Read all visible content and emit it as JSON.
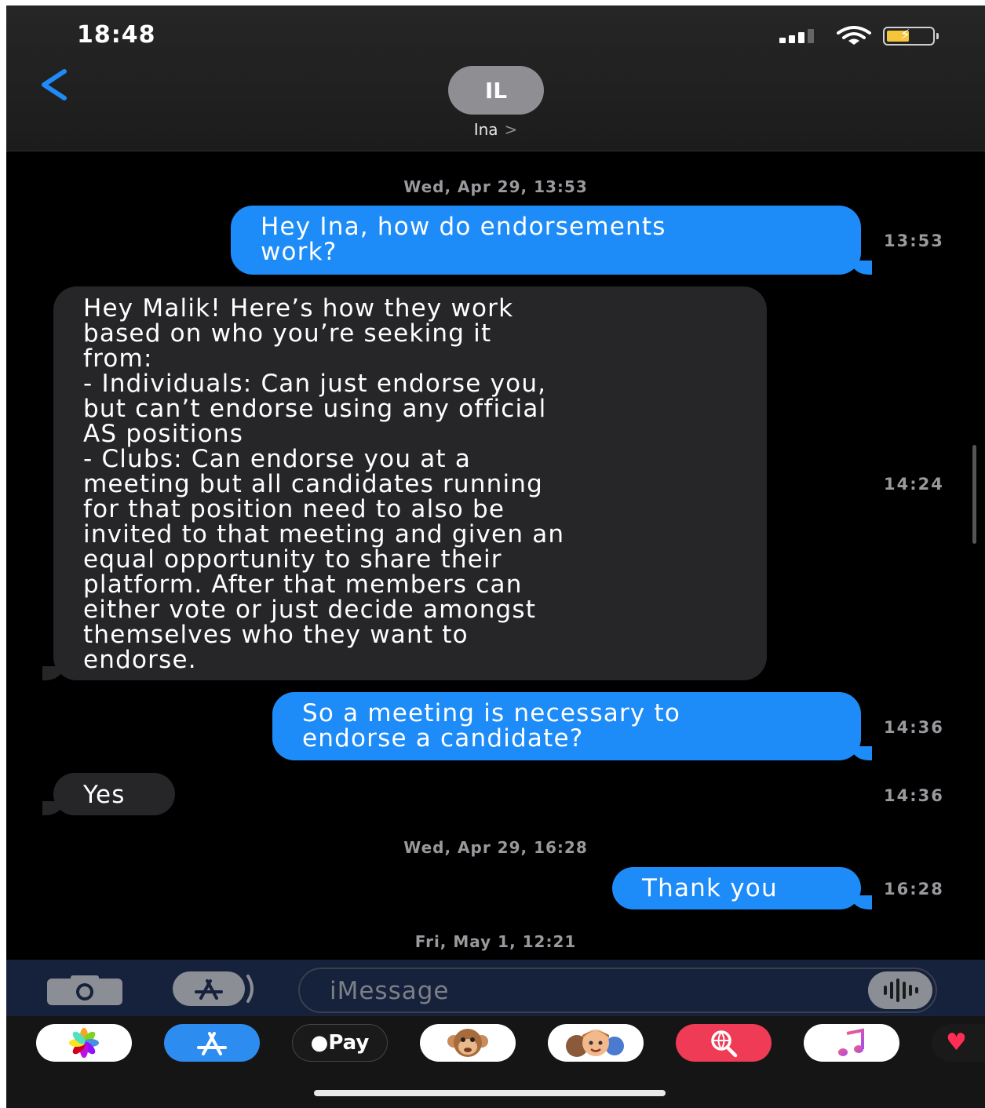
{
  "status_bar": {
    "time": "18:48"
  },
  "header": {
    "avatar_initials": "IL",
    "contact_name": "Ina",
    "chevron": ">"
  },
  "messages": [
    {
      "type": "timestamp",
      "text": "Wed, Apr 29, 13:53"
    },
    {
      "type": "sent",
      "text": "Hey Ina, how do endorsements\nwork?",
      "time": "13:53"
    },
    {
      "type": "received",
      "text": "Hey Malik! Here’s how they work\nbased on who you’re seeking it\nfrom:\n- Individuals: Can just endorse you,\nbut can’t endorse using any official\nAS positions\n- Clubs: Can endorse you at a\nmeeting but all candidates running\nfor that position need to also be\ninvited to that meeting and given an\nequal opportunity to share their\nplatform. After that members can\neither vote or just decide amongst\nthemselves who they want to\nendorse.",
      "time": "14:24"
    },
    {
      "type": "sent",
      "text": "So a meeting is necessary to\nendorse a candidate?",
      "time": "14:36"
    },
    {
      "type": "received",
      "text": "Yes",
      "time": "14:36"
    },
    {
      "type": "timestamp",
      "text": "Wed, Apr 29, 16:28"
    },
    {
      "type": "sent",
      "text": "Thank you",
      "time": "16:28"
    },
    {
      "type": "timestamp",
      "text": "Fri, May 1, 12:21"
    }
  ],
  "compose": {
    "placeholder": "iMessage"
  },
  "drawer": {
    "apps": [
      {
        "name": "photos-app",
        "label": ""
      },
      {
        "name": "app-store-app",
        "label": ""
      },
      {
        "name": "apple-pay-app",
        "label": "Pay"
      },
      {
        "name": "animoji-app",
        "label": ""
      },
      {
        "name": "memoji-stickers-app",
        "label": ""
      },
      {
        "name": "images-search-app",
        "label": ""
      },
      {
        "name": "music-app",
        "label": ""
      },
      {
        "name": "digital-touch-app",
        "label": ""
      }
    ]
  },
  "colors": {
    "sent_bubble": "#1d8cf8",
    "received_bubble": "#262629",
    "accent": "#1d8cf8"
  }
}
